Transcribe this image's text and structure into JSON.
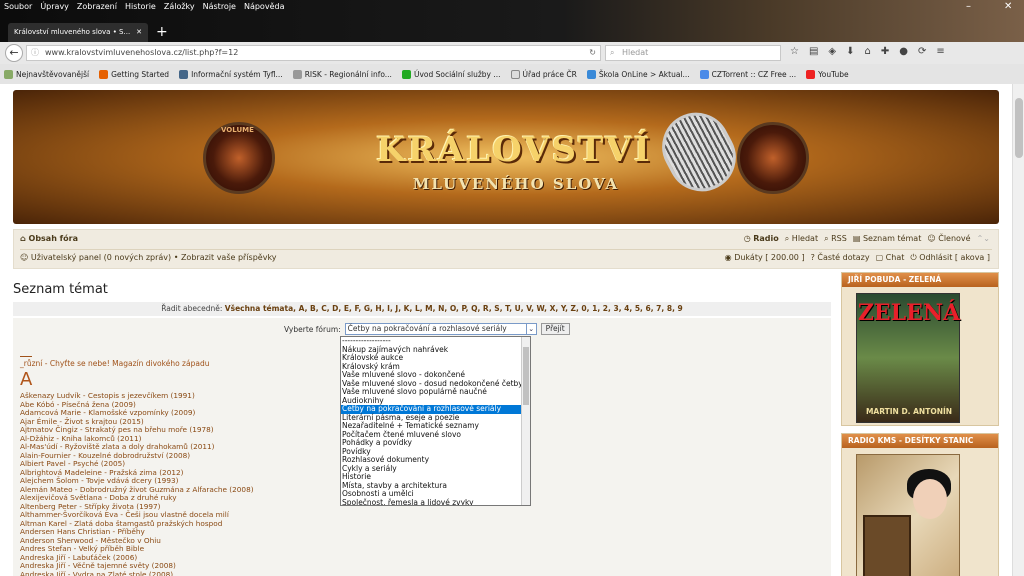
{
  "browser": {
    "menu": [
      "Soubor",
      "Úpravy",
      "Zobrazení",
      "Historie",
      "Záložky",
      "Nástroje",
      "Nápověda"
    ],
    "window_controls": {
      "minimize": "–",
      "close": "✕"
    },
    "tab_title": "Království mluveného slova • S...",
    "new_tab": "+",
    "url": "www.kralovstvimluvenehoslova.cz/list.php?f=12",
    "search_placeholder": "Hledat",
    "bookmarks": [
      "Nejnavštěvovanější",
      "Getting Started",
      "Informační systém Tyfl...",
      "RISK - Regionální info...",
      "Úvod Sociální služby ...",
      "Úřad práce ČR",
      "Škola OnLine > Aktual...",
      "CZTorrent :: CZ Free ...",
      "YouTube"
    ]
  },
  "banner": {
    "title": "KRÁLOVSTVÍ",
    "subtitle": "MLUVENÉHO SLOVA",
    "volume_label": "VOLUME"
  },
  "nav": {
    "index": "Obsah fóra",
    "links_right": [
      "Radio",
      "Hledat",
      "RSS",
      "Seznam témat",
      "Členové"
    ],
    "user_panel": "Uživatelský panel (0 nových zpráv)",
    "show_posts": "Zobrazit vaše příspěvky",
    "sep": "•",
    "ducats": "Dukáty [ 200.00 ]",
    "faq": "Časté dotazy",
    "chat": "Chat",
    "logout": "Odhlásit [ akova ]"
  },
  "main": {
    "title": "Seznam témat",
    "sort_label": "Řadit abecedně:",
    "sort_all": "Všechna témata",
    "letters": "A, B, C, D, E, F, G, H, I, J, K, L, M, N, O, P, Q, R, S, T, U, V, W, X, Y, Z, 0, 1, 2, 3, 4, 5, 6, 7, 8, 9",
    "forum_label": "Vyberte fórum:",
    "selected_forum": "Četby na pokračování a rozhlasové seriály",
    "go_button": "Přejít",
    "misc_topic": "_různí - Chyťte se nebe! Magazín divokého západu",
    "letter_heading": "A"
  },
  "dropdown_options": [
    "------------------",
    "Nákup zajímavých nahrávek",
    "Královské aukce",
    "Královský krám",
    "Vaše mluvené slovo - dokončené",
    "Vaše mluvené slovo - dosud nedokončené četby",
    "Vaše mluvené slovo populárně naučné",
    "Audioknihy",
    "Četby na pokračování a rozhlasové seriály",
    "Literární pásma, eseje a poezie",
    "Nezařaditelné + Tematické seznamy",
    "Počítačem čtené mluvené slovo",
    "Pohádky a povídky",
    "Povídky",
    "Rozhlasové dokumenty",
    "Cykly a seriály",
    "Historie",
    "Místa, stavby a architektura",
    "Osobnosti a umělci",
    "Společnost, řemesla a lidové zvyky"
  ],
  "dropdown_selected_index": 8,
  "topics": [
    "Aškenazy Ludvík - Cestopis s jezevčíkem (1991)",
    "Abe Kóbó - Písečná žena (2009)",
    "Adamcová Marie - Klamošské vzpomínky (2009)",
    "Ajar Émile - Život s krajtou (2015)",
    "Ajtmatov Čingiz - Strakatý pes na břehu moře (1978)",
    "Al-Džáhiz - Kniha lakomců (2011)",
    "Al-Mas'údí - Ryžoviště zlata a doly drahokamů (2011)",
    "Alain-Fournier - Kouzelné dobrodružství (2008)",
    "Albiert Pavel - Psyché (2005)",
    "Albrightová Madeleine - Pražská zima (2012)",
    "Alejchem Šolom - Tovje vdává dcery (1993)",
    "Alemán Mateo - Dobrodružný život Guzmána z Alfarache (2008)",
    "Alexijevičová Světlana - Doba z druhé ruky",
    "Altenberg Peter - Střípky života (1997)",
    "Althammer-Švorčíková Eva - Češi jsou vlastně docela milí",
    "Altman Karel - Zlatá doba štamgastů pražských hospod",
    "Andersen Hans Christian - Příběhy",
    "Anderson Sherwood - Městečko v Ohiu",
    "Andres Stefan - Velký příběh Bible",
    "Andreska Jiří - Labuťáček (2006)",
    "Andreska Jiří - Věčně tajemné světy (2008)",
    "Andreska Jiří - Vydra na Zlaté stole (2008)"
  ],
  "sidebar": {
    "box1_title": "JIŘÍ POBUDA - ZELENÁ",
    "box1_cover_title": "ZELENÁ",
    "box1_cover_author": "MARTIN D. ANTONÍN",
    "box2_title": "RADIO KMS - DESÍTKY STANIC"
  }
}
